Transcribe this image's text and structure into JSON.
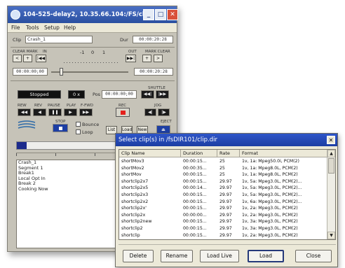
{
  "main_window": {
    "title": "104-525-delay2, 10.35.66.104:/FS/cli...",
    "menu": [
      "File",
      "Tools",
      "Setup",
      "Help"
    ],
    "clip_label": "Clip",
    "clip_name": "Crash_1",
    "dur_label": "Dur",
    "dur_value": "00:00:20:28",
    "clear_mark_label": "CLEAR MARK",
    "in_label": "IN",
    "out_label": "OUT",
    "mark_clear_label": "MARK CLEAR",
    "in_time": "00:00:00;00",
    "out_time": "00:00:20:28",
    "shuttle_scale": [
      "-1",
      "0",
      "1"
    ],
    "status": "Stopped",
    "speed": "0 x",
    "pos_label": "Pos",
    "pos_value": "00:00:00;00",
    "shuttle_label": "SHUTTLE",
    "transport_labels": [
      "REW",
      "REV",
      "PAUSE",
      "PLAY",
      "F-FWD"
    ],
    "rec_label": "REC",
    "jog_label": "JOG",
    "stop_label": "STOP",
    "eject_label": "EJECT",
    "bounce_label": "Bounce",
    "loop_label": "Loop",
    "list_buttons": [
      "List",
      "Load",
      "New"
    ],
    "progress": 0.1,
    "playlist": [
      "Crash_1",
      "Segment 1",
      "Break1",
      "Local Opt In",
      "Break 2",
      "Cooking Now"
    ]
  },
  "dialog": {
    "title": "Select clip(s) in /fsDIR101/clip.dir",
    "columns": [
      "Clip Name",
      "Duration",
      "Rate",
      "Format"
    ],
    "rows": [
      [
        "shortMov3",
        "00:00:15...",
        "25",
        "1v, 1a: Mpeg50.0i, PCM(2)"
      ],
      [
        "shortMov2",
        "00:00:35...",
        "25",
        "1v, 1a: Mpeg8.0L, PCM(2)"
      ],
      [
        "shortMov",
        "00:00:15...",
        "25",
        "1v, 1a: Mpeg8.0L, PCM(2)"
      ],
      [
        "shortclip2x7",
        "00:00:15...",
        "29.97",
        "1v, 5a: Mpeg3.0L, PCM(2)..."
      ],
      [
        "shortclip2x5",
        "00:00:14...",
        "29.97",
        "1v, 5a: Mpeg3.0L, PCM(2)..."
      ],
      [
        "shortclip2x3",
        "00:00:15...",
        "29.97",
        "1v, 5a: Mpeg3.0L, PCM(2)..."
      ],
      [
        "shortclip2x2",
        "00:00:15...",
        "29.97",
        "1v, 6a: Mpeg3.0L, PCM(2)..."
      ],
      [
        "shortclip2x'",
        "00:00:15...",
        "29.97",
        "1v, 2a: Mpeg3.0L, PCM(2)"
      ],
      [
        "shortclip2x",
        "00:00:00...",
        "29.97",
        "1v, 2a: Mpeg3.0L, PCM(2)"
      ],
      [
        "shortclip2new",
        "00:00:15...",
        "29.97",
        "1v, 3a: Mpeg3.0L, PCM(2)"
      ],
      [
        "shortclip2",
        "00:00:15...",
        "29.97",
        "1v, 3a: Mpeg3.0L, PCM(2)"
      ],
      [
        "shortclip",
        "00:00:15...",
        "29.97",
        "1v, 2a: Mpeg3.0L, PCM(2)"
      ]
    ],
    "buttons": [
      "Delete",
      "Rename",
      "Load Live",
      "Load",
      "Close"
    ]
  },
  "icons": {
    "close": "close-icon",
    "minimize": "minimize-icon",
    "maximize": "maximize-icon",
    "logo": "logo-stripes-icon"
  },
  "colors": {
    "titlebar": "#2a4fa0",
    "window_bg": "#c6c3b8",
    "progress": "#1c2b8c",
    "rec": "#e4201b",
    "dialog_bg": "#ece9d8"
  }
}
